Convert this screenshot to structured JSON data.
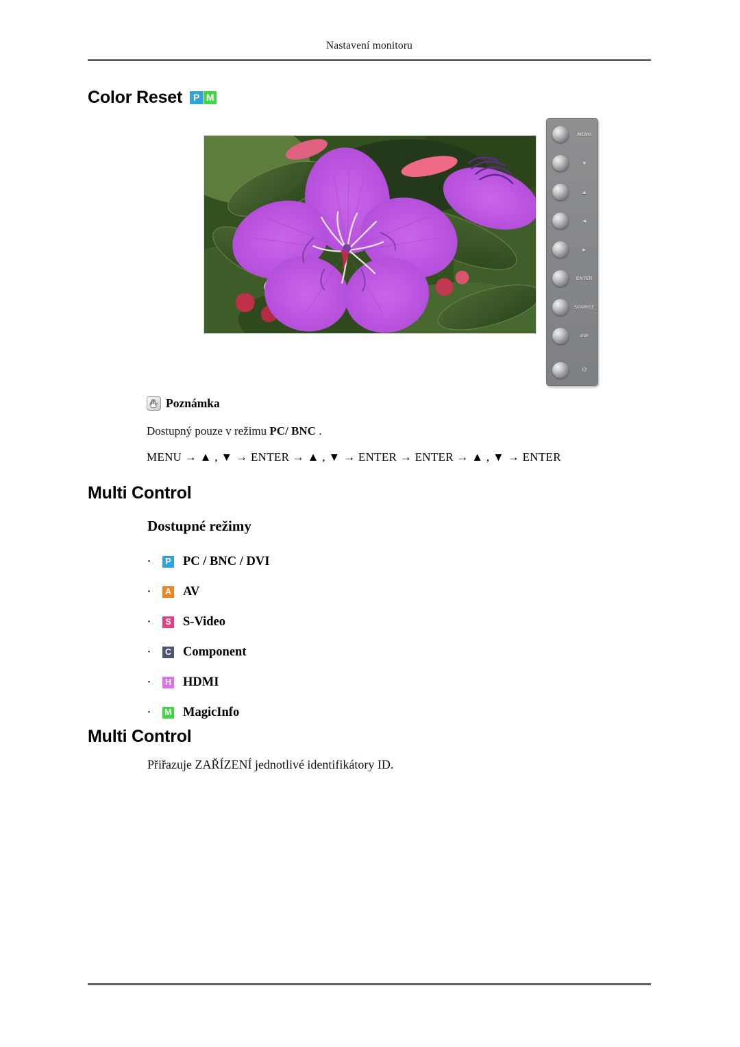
{
  "page": {
    "running_header": "Nastavení monitoru"
  },
  "sections": {
    "color_reset": {
      "title": "Color Reset",
      "badges": [
        {
          "letter": "P",
          "color": "#2ea3dd",
          "name": "badge-pc"
        },
        {
          "letter": "M",
          "color": "#3dd742",
          "name": "badge-magicinfo"
        }
      ]
    },
    "multi_control_1": {
      "title": "Multi Control"
    },
    "multi_control_2": {
      "title": "Multi Control"
    }
  },
  "note": {
    "icon_name": "note-hand-icon",
    "label": "Poznámka",
    "line_prefix": "Dostupný pouze v režimu ",
    "line_bold": "PC/ BNC",
    "line_suffix": " .",
    "sequence": "MENU → ▲ , ▼ → ENTER → ▲ , ▼ → ENTER → ENTER → ▲ , ▼ → ENTER"
  },
  "available_modes": {
    "heading": "Dostupné režimy",
    "bullet": "·",
    "items": [
      {
        "badge": "P",
        "color": "#2ea3dd",
        "label": "PC / BNC / DVI",
        "name": "mode-pc-bnc-dvi"
      },
      {
        "badge": "A",
        "color": "#f58220",
        "label": "AV",
        "name": "mode-av"
      },
      {
        "badge": "S",
        "color": "#e8407f",
        "label": "S-Video",
        "name": "mode-s-video"
      },
      {
        "badge": "C",
        "color": "#4c5470",
        "label": "Component",
        "name": "mode-component"
      },
      {
        "badge": "H",
        "color": "#e36ef0",
        "label": "HDMI",
        "name": "mode-hdmi"
      },
      {
        "badge": "M",
        "color": "#3dd742",
        "label": "MagicInfo",
        "name": "mode-magicinfo"
      }
    ]
  },
  "description": {
    "text": "Přiřazuje ZAŘÍZENÍ jednotlivé identifikátory ID."
  },
  "control_panel": {
    "buttons": [
      {
        "label": "MENU",
        "name": "panel-button-menu",
        "glyph": false
      },
      {
        "label": "▼",
        "name": "panel-button-down",
        "glyph": true
      },
      {
        "label": "▲",
        "name": "panel-button-up",
        "glyph": true
      },
      {
        "label": "◄",
        "name": "panel-button-left",
        "glyph": true
      },
      {
        "label": "►",
        "name": "panel-button-right",
        "glyph": true
      },
      {
        "label": "ENTER",
        "name": "panel-button-enter",
        "glyph": false
      },
      {
        "label": "SOURCE",
        "name": "panel-button-source",
        "glyph": false
      },
      {
        "label": "PIP",
        "name": "panel-button-pip",
        "glyph": false
      },
      {
        "label": "⏻",
        "name": "panel-button-power",
        "glyph": true
      }
    ]
  },
  "screenshot_image": {
    "name": "flower-photo",
    "subject": "purple tibouchina flower on green foliage"
  }
}
